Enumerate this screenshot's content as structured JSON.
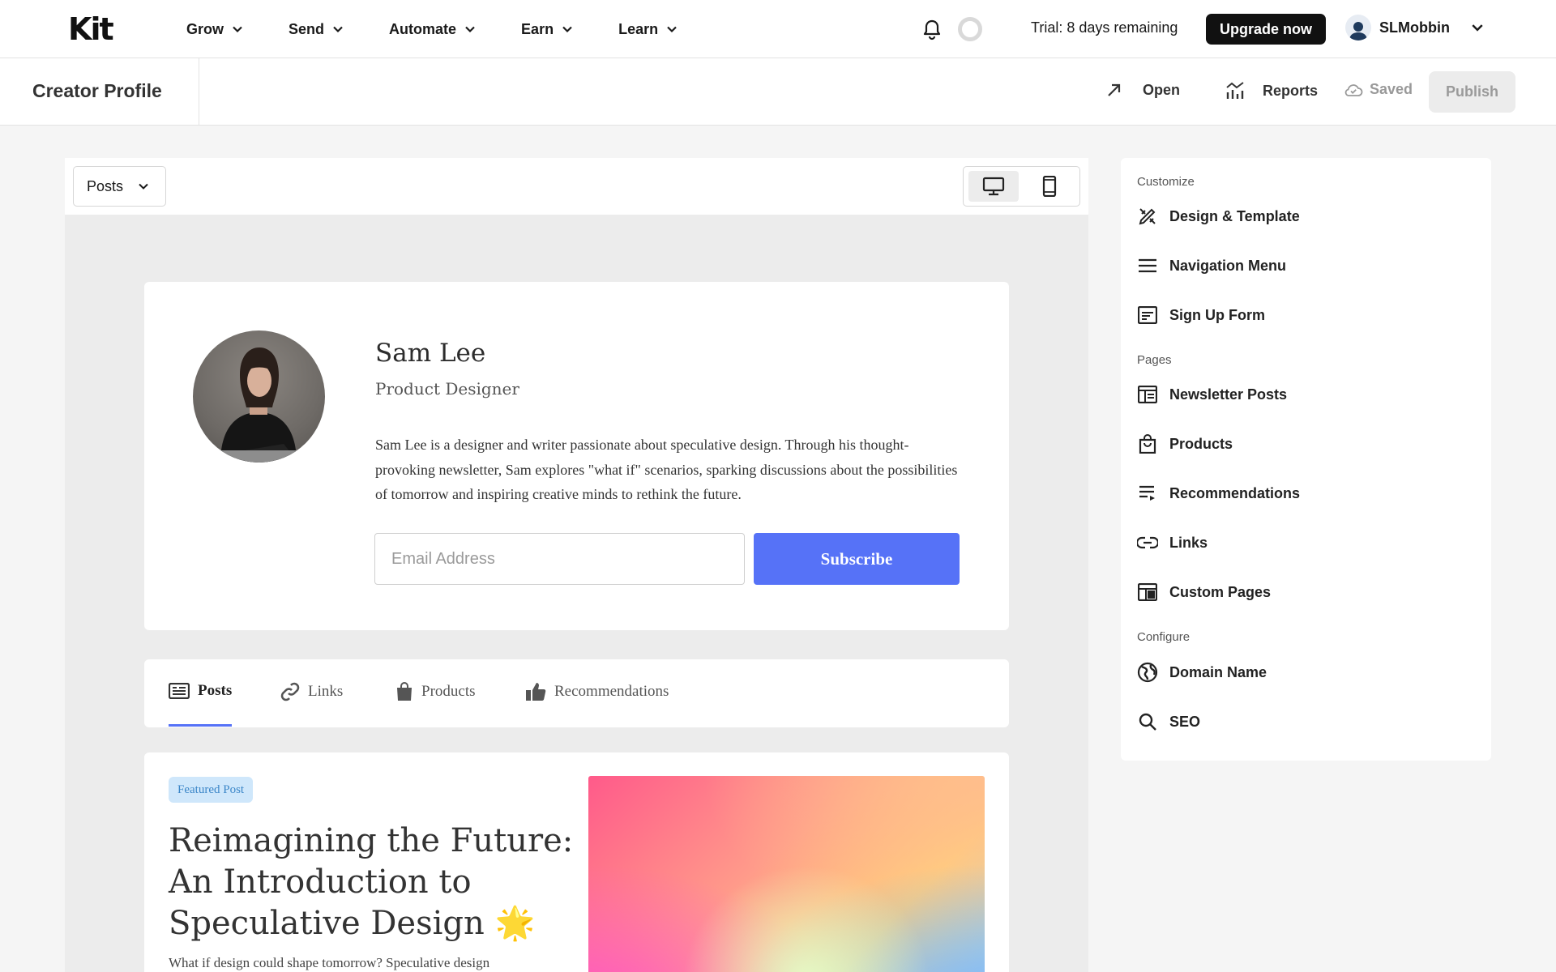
{
  "brand": {
    "logo": "Kit"
  },
  "topnav": {
    "items": [
      {
        "label": "Grow"
      },
      {
        "label": "Send"
      },
      {
        "label": "Automate"
      },
      {
        "label": "Earn"
      },
      {
        "label": "Learn"
      }
    ],
    "trial_text": "Trial: 8 days remaining",
    "upgrade_label": "Upgrade now",
    "username": "SLMobbin"
  },
  "subbar": {
    "title": "Creator Profile",
    "open_label": "Open",
    "reports_label": "Reports",
    "saved_label": "Saved",
    "publish_label": "Publish"
  },
  "preview": {
    "page_select": "Posts",
    "profile": {
      "name": "Sam Lee",
      "role": "Product Designer",
      "bio": "Sam Lee is a designer and writer passionate about speculative design. Through his thought-provoking newsletter, Sam explores \"what if\" scenarios, sparking discussions about the possibilities of tomorrow and inspiring creative minds to rethink the future.",
      "email_placeholder": "Email Address",
      "subscribe_label": "Subscribe"
    },
    "tabs": [
      {
        "label": "Posts",
        "active": true
      },
      {
        "label": "Links"
      },
      {
        "label": "Products"
      },
      {
        "label": "Recommendations"
      }
    ],
    "featured": {
      "badge": "Featured Post",
      "title": "Reimagining the Future: An Introduction to Speculative Design 🌟",
      "excerpt": "What if design could shape tomorrow? Speculative design"
    }
  },
  "panel": {
    "customize_heading": "Customize",
    "customize": [
      {
        "label": "Design & Template",
        "icon": "design-icon"
      },
      {
        "label": "Navigation Menu",
        "icon": "menu-icon"
      },
      {
        "label": "Sign Up Form",
        "icon": "form-icon"
      }
    ],
    "pages_heading": "Pages",
    "pages": [
      {
        "label": "Newsletter Posts",
        "icon": "newsletter-icon"
      },
      {
        "label": "Products",
        "icon": "shopping-bag-icon"
      },
      {
        "label": "Recommendations",
        "icon": "list-icon"
      },
      {
        "label": "Links",
        "icon": "link-icon"
      },
      {
        "label": "Custom Pages",
        "icon": "layout-icon"
      }
    ],
    "configure_heading": "Configure",
    "configure": [
      {
        "label": "Domain Name",
        "icon": "globe-icon"
      },
      {
        "label": "SEO",
        "icon": "search-icon"
      }
    ]
  },
  "colors": {
    "accent": "#5672f7",
    "badge_bg": "#cfe7fb",
    "badge_text": "#3b86c8"
  }
}
